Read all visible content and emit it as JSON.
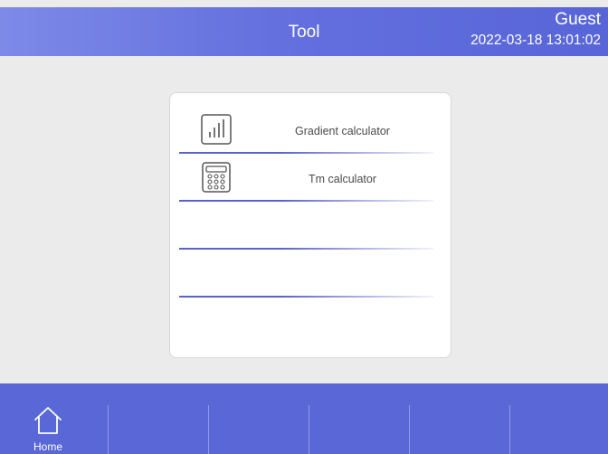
{
  "header": {
    "title": "Tool",
    "user": "Guest",
    "datetime": "2022-03-18 13:01:02"
  },
  "tools": [
    {
      "label": "Gradient calculator",
      "icon": "bar-chart-icon"
    },
    {
      "label": "Tm calculator",
      "icon": "calculator-icon"
    },
    {
      "label": "",
      "icon": ""
    },
    {
      "label": "",
      "icon": ""
    }
  ],
  "nav": {
    "home_label": "Home",
    "home_icon": "home-icon"
  },
  "colors": {
    "header_start": "#7d8ae8",
    "header_end": "#5865d8",
    "nav_bar": "#5a67d6",
    "divider": "#5763cf",
    "background": "#ebebeb"
  }
}
